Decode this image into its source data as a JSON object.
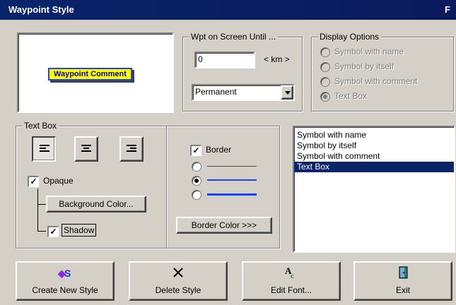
{
  "window": {
    "title": "Waypoint Style",
    "title_right": "F"
  },
  "preview": {
    "text": "Waypoint Comment"
  },
  "wpt_on_screen": {
    "legend": "Wpt on Screen Until ...",
    "distance_value": "0",
    "unit_label": "< km >",
    "mode_value": "Permanent"
  },
  "display_options": {
    "legend": "Display Options",
    "options": [
      {
        "label": "Symbol with name",
        "selected": false
      },
      {
        "label": "Symbol by itself",
        "selected": false
      },
      {
        "label": "Symbol with comment",
        "selected": false
      },
      {
        "label": "Text Box",
        "selected": true
      }
    ]
  },
  "text_box": {
    "legend": "Text Box",
    "align_buttons": [
      "align-left",
      "align-center",
      "align-right"
    ],
    "opaque_label": "Opaque",
    "opaque_checked": true,
    "background_button": "Background Color...",
    "shadow_label": "Shadow",
    "shadow_checked": true,
    "border_label": "Border",
    "border_checked": true,
    "border_widths": [
      {
        "width": "thin",
        "selected": false
      },
      {
        "width": "medium",
        "selected": true
      },
      {
        "width": "thick",
        "selected": false
      }
    ],
    "border_color_button": "Border Color >>>"
  },
  "style_list": {
    "items": [
      "Symbol with name",
      "Symbol by itself",
      "Symbol with comment",
      "Text Box"
    ],
    "selected_index": 3
  },
  "buttons": {
    "create": "Create New Style",
    "delete": "Delete Style",
    "edit_font": "Edit Font...",
    "exit": "Exit"
  },
  "colors": {
    "title_bar": "#0a246a",
    "preview_fill": "#ffff00",
    "preview_text": "#0000a0",
    "border_line": "#2244dd",
    "selection": "#0a246a"
  }
}
